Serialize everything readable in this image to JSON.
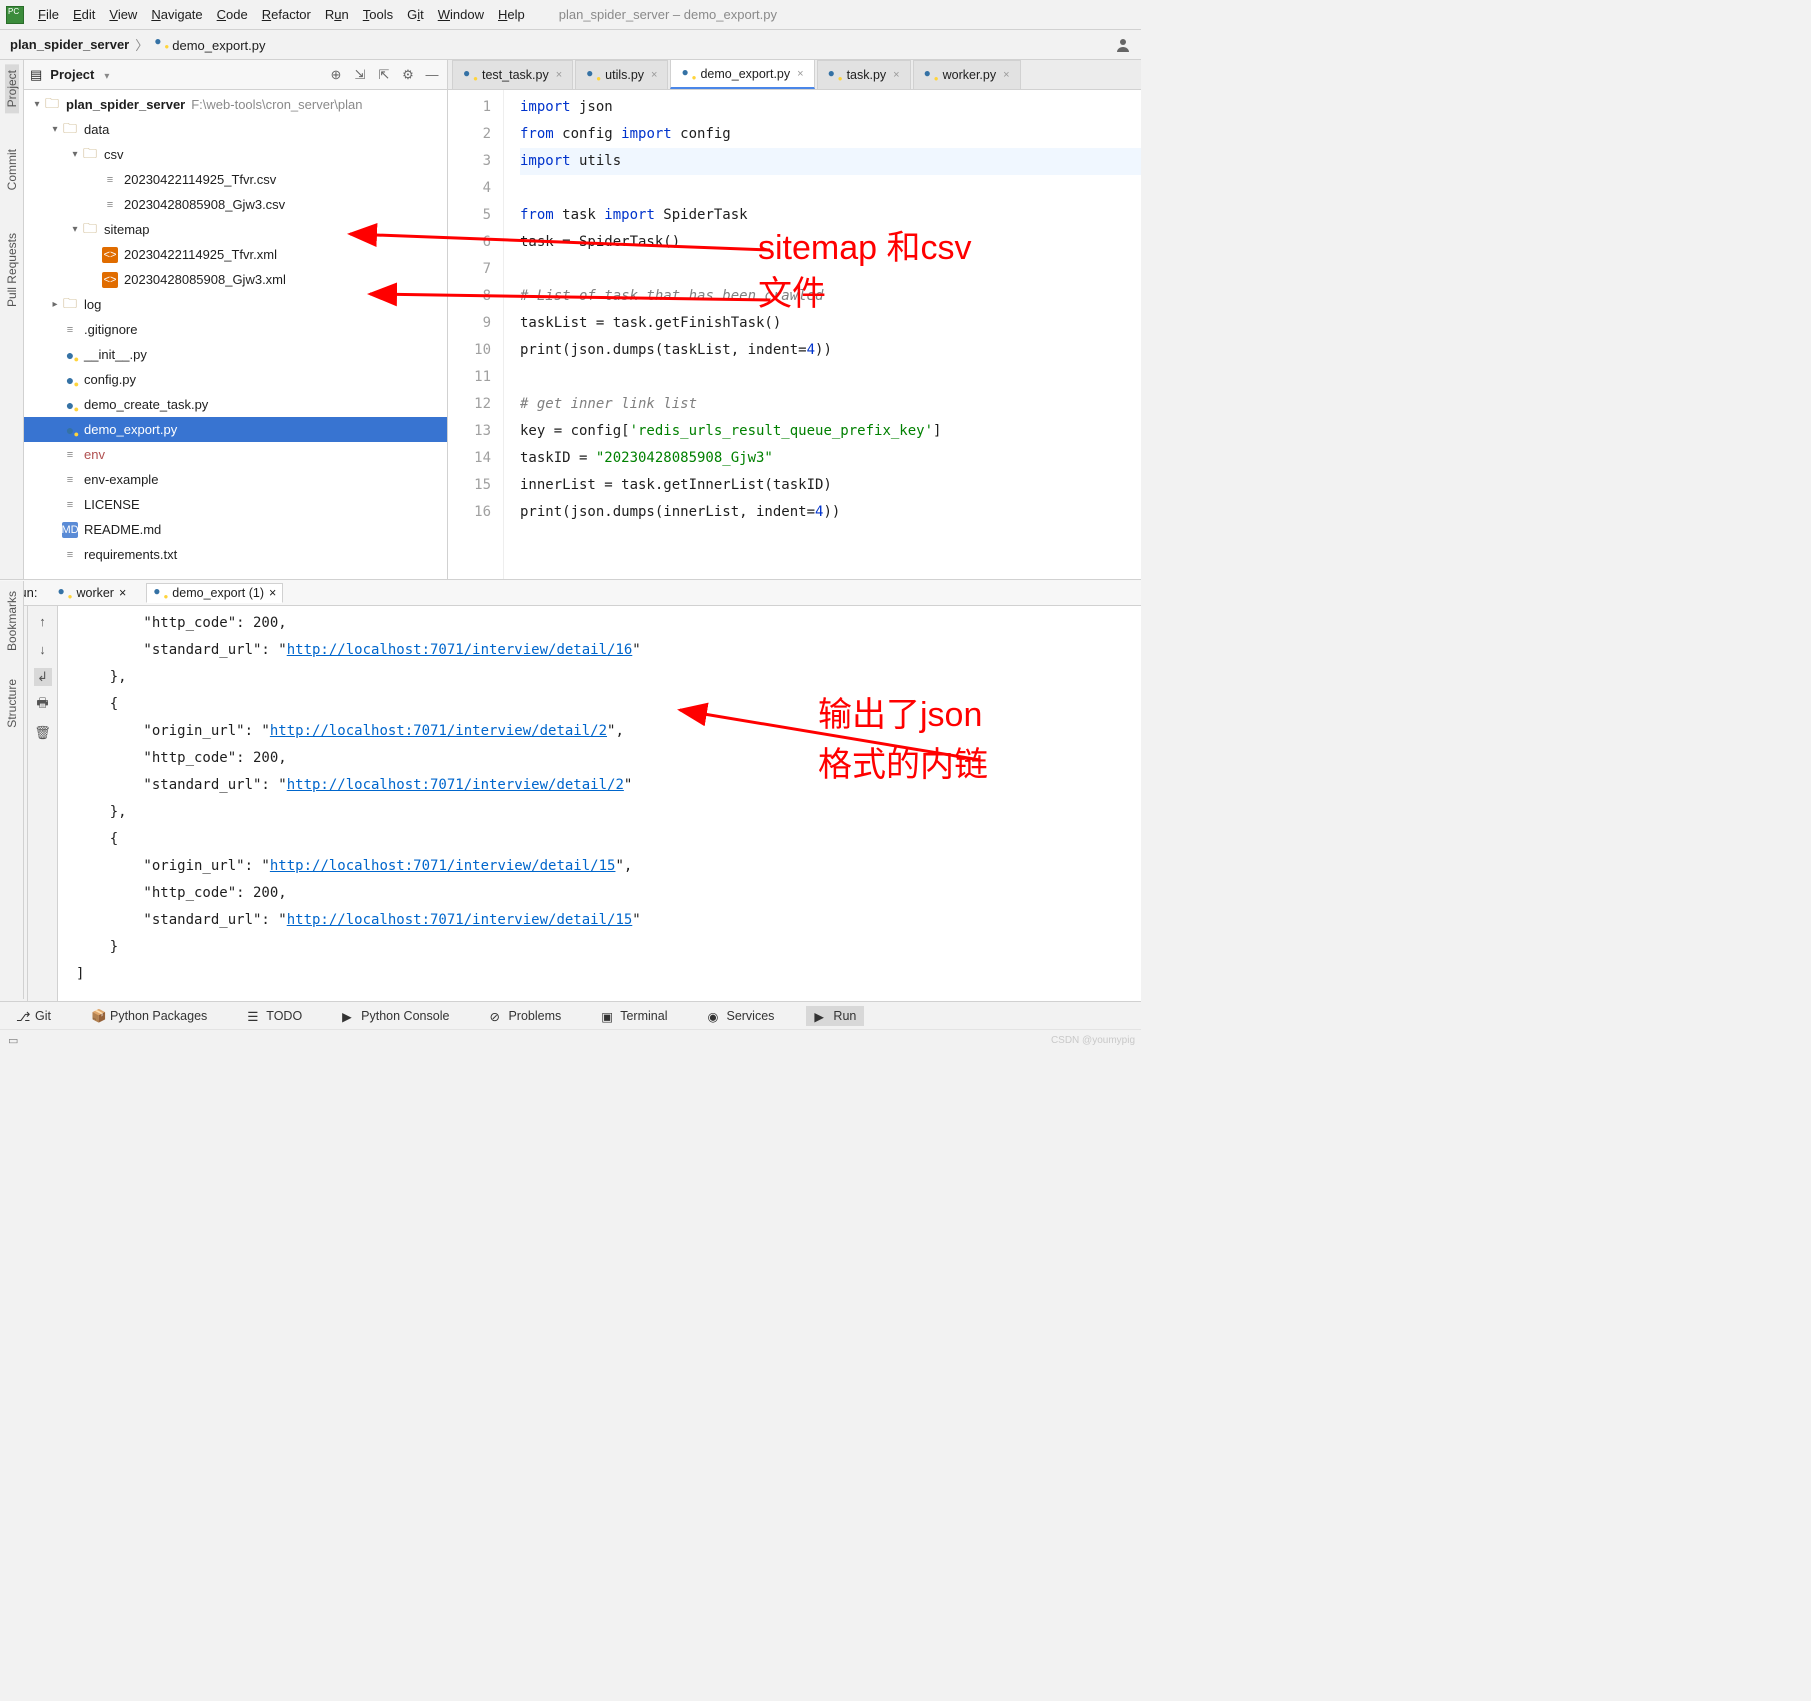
{
  "window_title": "plan_spider_server – demo_export.py",
  "menu": {
    "items": [
      "File",
      "Edit",
      "View",
      "Navigate",
      "Code",
      "Refactor",
      "Run",
      "Tools",
      "Git",
      "Window",
      "Help"
    ]
  },
  "breadcrumb": {
    "root": "plan_spider_server",
    "file": "demo_export.py"
  },
  "left_stripes": [
    "Project",
    "Commit",
    "Pull Requests"
  ],
  "left_stripes_bottom": [
    "Bookmarks",
    "Structure"
  ],
  "project_header": {
    "title": "Project"
  },
  "tree": {
    "root": {
      "label": "plan_spider_server",
      "path": "F:\\web-tools\\cron_server\\plan"
    },
    "data": {
      "label": "data"
    },
    "csv": {
      "label": "csv",
      "files": [
        "20230422114925_Tfvr.csv",
        "20230428085908_Gjw3.csv"
      ]
    },
    "sitemap": {
      "label": "sitemap",
      "files": [
        "20230422114925_Tfvr.xml",
        "20230428085908_Gjw3.xml"
      ]
    },
    "log": {
      "label": "log"
    },
    "files": [
      ".gitignore",
      "__init__.py",
      "config.py",
      "demo_create_task.py",
      "demo_export.py",
      "env",
      "env-example",
      "LICENSE",
      "README.md",
      "requirements.txt"
    ]
  },
  "tabs": [
    {
      "label": "test_task.py",
      "active": false
    },
    {
      "label": "utils.py",
      "active": false
    },
    {
      "label": "demo_export.py",
      "active": true
    },
    {
      "label": "task.py",
      "active": false
    },
    {
      "label": "worker.py",
      "active": false
    }
  ],
  "code": {
    "lines": [
      {
        "n": 1,
        "html": "<span class='k'>import</span> json"
      },
      {
        "n": 2,
        "html": "<span class='k'>from</span> config <span class='k'>import</span> config"
      },
      {
        "n": 3,
        "html": "<span class='k'>import</span> utils",
        "hl": true
      },
      {
        "n": 4,
        "html": ""
      },
      {
        "n": 5,
        "html": "<span class='k'>from</span> task <span class='k'>import</span> SpiderTask"
      },
      {
        "n": 6,
        "html": "task = SpiderTask()"
      },
      {
        "n": 7,
        "html": ""
      },
      {
        "n": 8,
        "html": "<span class='c'># List of task that has been crawled</span>"
      },
      {
        "n": 9,
        "html": "taskList = task.getFinishTask()"
      },
      {
        "n": 10,
        "html": "print(json.dumps(taskList, indent=<span class='k'>4</span>))"
      },
      {
        "n": 11,
        "html": ""
      },
      {
        "n": 12,
        "html": "<span class='c'># get inner link list</span>"
      },
      {
        "n": 13,
        "html": "key = config[<span class='s'>'redis_urls_result_queue_prefix_key'</span>]"
      },
      {
        "n": 14,
        "html": "taskID = <span class='s'>\"20230428085908_Gjw3\"</span>"
      },
      {
        "n": 15,
        "html": "innerList = task.getInnerList(taskID)"
      },
      {
        "n": 16,
        "html": "print(json.dumps(innerList, indent=<span class='k'>4</span>))"
      }
    ]
  },
  "run_header": {
    "label": "Run:",
    "tabs": [
      {
        "label": "worker"
      },
      {
        "label": "demo_export (1)",
        "active": true
      }
    ]
  },
  "console_lines": [
    "        \"http_code\": 200,",
    "        \"standard_url\": \"<a>http://localhost:7071/interview/detail/16</a>\"",
    "    },",
    "    {",
    "        \"origin_url\": \"<a>http://localhost:7071/interview/detail/2</a>\",",
    "        \"http_code\": 200,",
    "        \"standard_url\": \"<a>http://localhost:7071/interview/detail/2</a>\"",
    "    },",
    "    {",
    "        \"origin_url\": \"<a>http://localhost:7071/interview/detail/15</a>\",",
    "        \"http_code\": 200,",
    "        \"standard_url\": \"<a>http://localhost:7071/interview/detail/15</a>\"",
    "    }",
    "]"
  ],
  "bottom_bar": [
    {
      "label": "Git",
      "icon": "⎇"
    },
    {
      "label": "Python Packages",
      "icon": "📦"
    },
    {
      "label": "TODO",
      "icon": "☰"
    },
    {
      "label": "Python Console",
      "icon": "▶"
    },
    {
      "label": "Problems",
      "icon": "⊘"
    },
    {
      "label": "Terminal",
      "icon": "▣"
    },
    {
      "label": "Services",
      "icon": "◉"
    },
    {
      "label": "Run",
      "icon": "▶",
      "active": true
    }
  ],
  "status": {
    "left_icon": "▭",
    "watermark": "CSDN @youmypig"
  },
  "annotations": {
    "a1_line1": "sitemap 和csv",
    "a1_line2": "文件",
    "a2_line1": "输出了json",
    "a2_line2": "格式的内链"
  }
}
